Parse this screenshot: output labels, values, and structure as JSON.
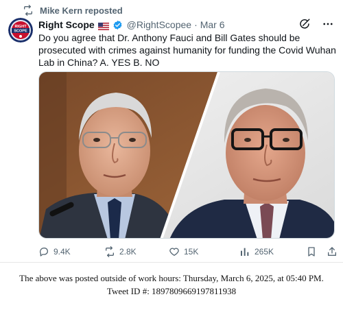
{
  "repost": {
    "label": "Mike Kern reposted",
    "icon": "repost-icon"
  },
  "author": {
    "name": "Right Scope",
    "handle": "@RightScopee",
    "separator": "·",
    "time": "Mar 6",
    "flag_icon": "us-flag-icon",
    "verified_icon": "verified-badge-icon",
    "avatar_text": "RIGHT SCOPE",
    "accent": "#1d9bf0"
  },
  "tweet": {
    "text": "Do you agree that Dr. Anthony Fauci and Bill Gates should be prosecuted with crimes against humanity for funding the Covid Wuhan Lab in China? A. YES B. NO"
  },
  "header_actions": [
    {
      "icon": "grok-icon"
    },
    {
      "icon": "more-icon"
    }
  ],
  "actions": {
    "reply": {
      "icon": "reply-icon",
      "count": "9.4K"
    },
    "repost": {
      "icon": "repost-icon",
      "count": "2.8K"
    },
    "like": {
      "icon": "heart-icon",
      "count": "15K"
    },
    "views": {
      "icon": "views-icon",
      "count": "265K"
    },
    "bookmark": {
      "icon": "bookmark-icon"
    },
    "share": {
      "icon": "share-icon"
    }
  },
  "footer": {
    "line1": "The above was posted outside of work hours: Thursday, March 6, 2025, at 05:40 PM.",
    "line2": "Tweet ID #: 1897809669197811938"
  }
}
